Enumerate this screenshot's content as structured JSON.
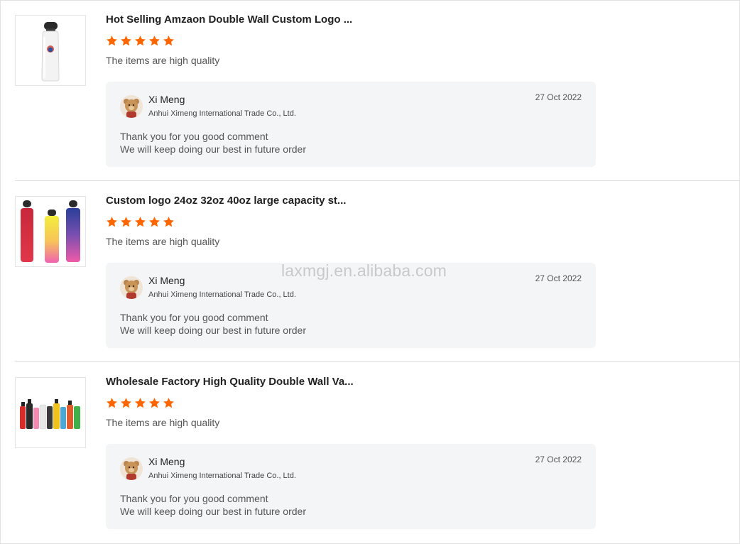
{
  "watermark": "laxmgj.en.alibaba.com",
  "colors": {
    "star": "#ff6600",
    "reply_bg": "#f4f5f7",
    "divider": "#dcdcdc"
  },
  "reviews": [
    {
      "product_title": "Hot Selling Amzaon Double Wall Custom Logo ...",
      "product_image": "white-bottle-image",
      "rating": 5,
      "rating_max": 5,
      "comment": "The items are high quality",
      "reply": {
        "seller_name": "Xi Meng",
        "company": "Anhui Ximeng International Trade Co., Ltd.",
        "date": "27 Oct 2022",
        "line1": "Thank you for you good comment",
        "line2": "We will keep doing our best in future order"
      }
    },
    {
      "product_title": "Custom logo 24oz 32oz 40oz large capacity st...",
      "product_image": "gradient-bottles-image",
      "rating": 5,
      "rating_max": 5,
      "comment": "The items are high quality",
      "reply": {
        "seller_name": "Xi Meng",
        "company": "Anhui Ximeng International Trade Co., Ltd.",
        "date": "27 Oct 2022",
        "line1": "Thank you for you good comment",
        "line2": "We will keep doing our best in future order"
      }
    },
    {
      "product_title": "Wholesale Factory High Quality Double Wall Va...",
      "product_image": "colorful-bottles-row-image",
      "rating": 5,
      "rating_max": 5,
      "comment": "The items are high quality",
      "reply": {
        "seller_name": "Xi Meng",
        "company": "Anhui Ximeng International Trade Co., Ltd.",
        "date": "27 Oct 2022",
        "line1": "Thank you for you good comment",
        "line2": "We will keep doing our best in future order"
      }
    }
  ]
}
